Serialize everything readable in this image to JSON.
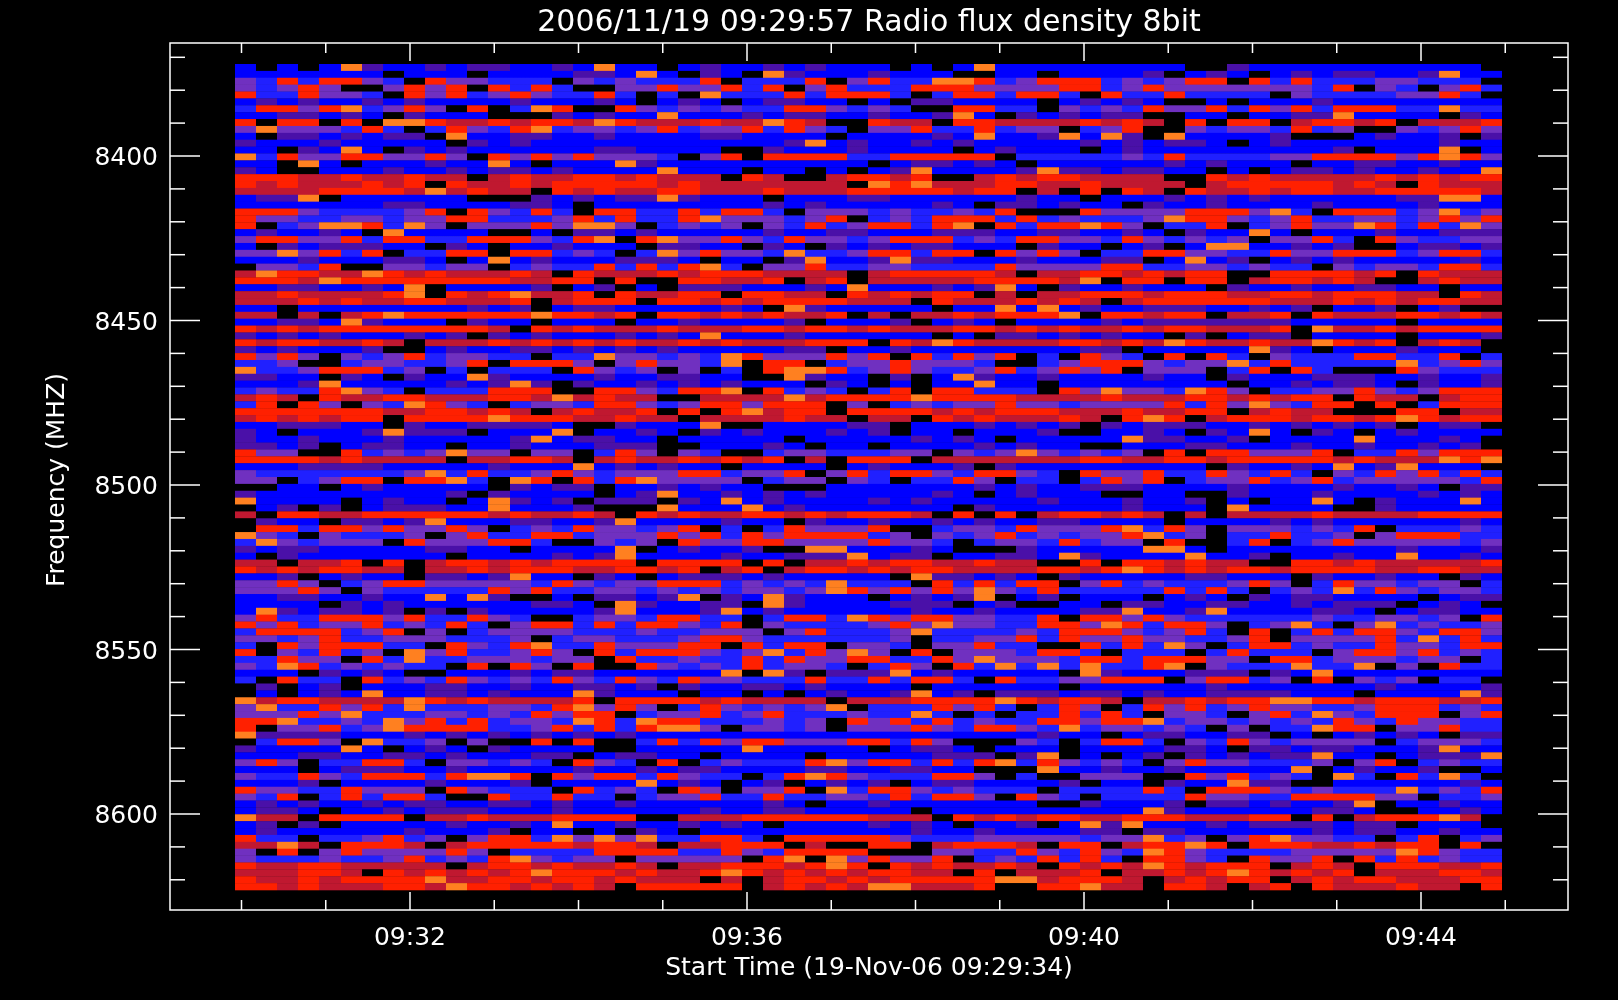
{
  "title": "2006/11/19 09:29:57 Radio flux density 8bit",
  "y_axis": {
    "label": "Frequency (MHZ)",
    "ticks": [
      "8400",
      "8450",
      "8500",
      "8550",
      "8600"
    ]
  },
  "x_axis": {
    "label": "Start Time (19-Nov-06 09:29:34)",
    "ticks": [
      "09:32",
      "09:36",
      "09:40",
      "09:44"
    ]
  }
}
